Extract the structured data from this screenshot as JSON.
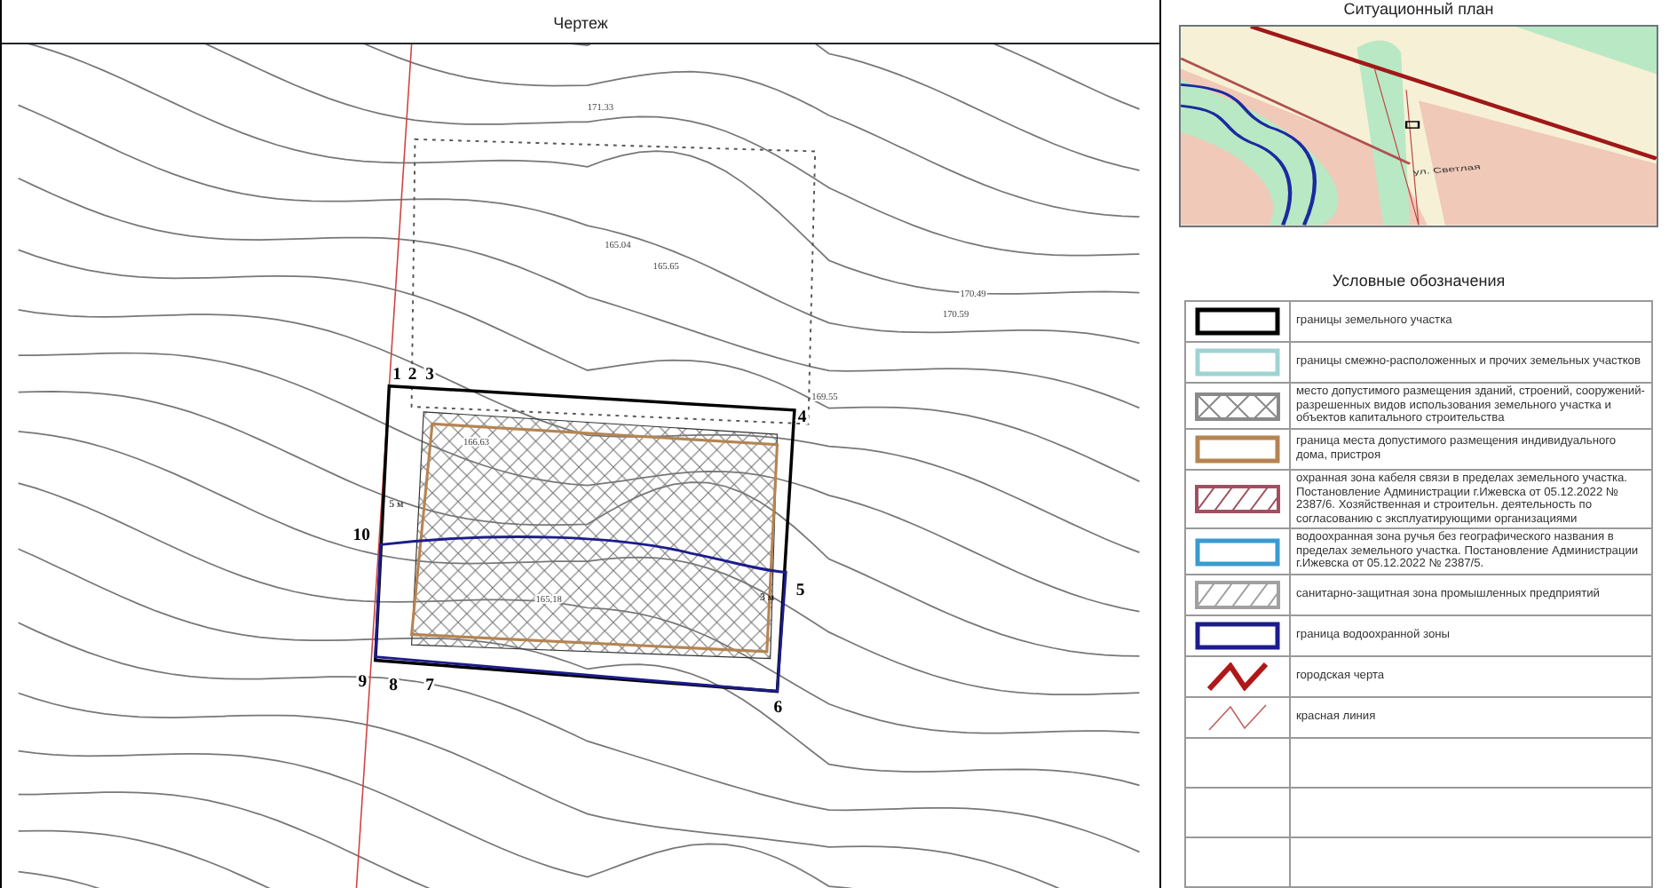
{
  "drawing": {
    "title": "Чертеж",
    "point_labels": [
      "1",
      "2",
      "3",
      "4",
      "10",
      "5",
      "9",
      "8",
      "7",
      "6"
    ],
    "dimension_labels": [
      "5 м",
      "3 м"
    ],
    "elevation_labels": [
      "171.33",
      "165.04",
      "165.65",
      "170.49",
      "170.59",
      "169.55",
      "166.63",
      "165.18"
    ]
  },
  "situation_plan": {
    "title": "Ситуационный план",
    "street_labels": [
      "ул. Светлая"
    ]
  },
  "legend": {
    "title": "Условные обозначения",
    "items": [
      {
        "kind": "frame",
        "color": "#000000",
        "label": "границы земельного участка"
      },
      {
        "kind": "frame",
        "color": "#9fd3d3",
        "label": "границы смежно-расположенных и прочих земельных участков"
      },
      {
        "kind": "crosshatch",
        "color": "#8a8a8a",
        "label": "место допустимого размещения зданий, строений, сооружений-разрешенных видов использования земельного участка и объектов капитального строительства"
      },
      {
        "kind": "frame",
        "color": "#b58452",
        "label": "граница места допустимого размещения индивидуального дома, пристроя"
      },
      {
        "kind": "hatch",
        "color": "#a05060",
        "label": "охранная зона кабеля связи в пределах земельного участка. Постановление Администрации г.Ижевска от 05.12.2022 № 2387/6. Хозяйственная и строительн. деятельность по согласованию с эксплуатирующими организациями"
      },
      {
        "kind": "frame",
        "color": "#3a9ad0",
        "label": "водоохранная зона ручья без географического названия в пределах земельного участка. Постановление Администрации г.Ижевска от 05.12.2022 № 2387/5."
      },
      {
        "kind": "hatch",
        "color": "#a0a0a0",
        "label": "санитарно-защитная зона промышленных предприятий"
      },
      {
        "kind": "frame",
        "color": "#1c1c8c",
        "label": "граница водоохранной зоны"
      },
      {
        "kind": "bolt",
        "color": "#b01818",
        "label": "городская черта"
      },
      {
        "kind": "thinbolt",
        "color": "#c06060",
        "label": "красная линия"
      }
    ]
  }
}
